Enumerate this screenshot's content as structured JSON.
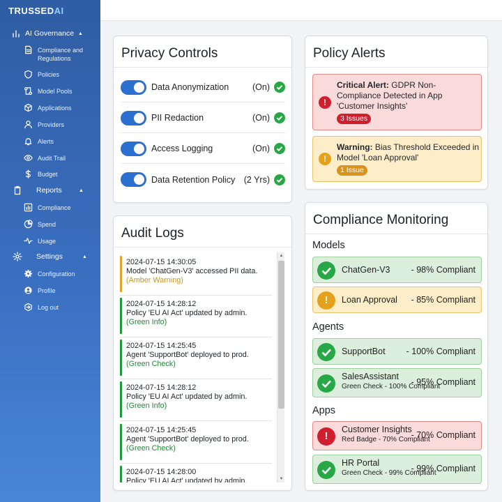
{
  "brand": {
    "name": "TRUSSED",
    "ai_mark": "AI"
  },
  "sidebar": {
    "ai_governance": {
      "label": "AI Governance",
      "items": [
        {
          "label": "Compliance and Regulations",
          "icon": "document-icon"
        },
        {
          "label": "Policies",
          "icon": "shield-icon"
        },
        {
          "label": "Model Pools",
          "icon": "model-pool-icon"
        },
        {
          "label": "Applications",
          "icon": "cube-icon"
        },
        {
          "label": "Providers",
          "icon": "user-icon"
        },
        {
          "label": "Alerts",
          "icon": "bell-icon"
        },
        {
          "label": "Audit Trail",
          "icon": "eye-icon"
        },
        {
          "label": "Budget",
          "icon": "dollar-icon"
        }
      ]
    },
    "reports": {
      "label": "Reports",
      "items": [
        {
          "label": "Compliance",
          "icon": "bar-chart-icon"
        },
        {
          "label": "Spend",
          "icon": "pie-chart-icon"
        },
        {
          "label": "Usage",
          "icon": "activity-icon"
        }
      ]
    },
    "settings": {
      "label": "Settings",
      "items": [
        {
          "label": "Configuration",
          "icon": "gear-icon"
        },
        {
          "label": "Profile",
          "icon": "profile-icon"
        },
        {
          "label": "Log out",
          "icon": "logout-icon"
        }
      ]
    }
  },
  "privacy_controls": {
    "title": "Privacy Controls",
    "rows": [
      {
        "label": "Data Anonymization",
        "state": "(On)"
      },
      {
        "label": "PII Redaction",
        "state": "(On)"
      },
      {
        "label": "Access Logging",
        "state": "(On)"
      },
      {
        "label": "Data Retention Policy",
        "state": "(2 Yrs)"
      }
    ]
  },
  "audit_logs": {
    "title": "Audit Logs",
    "entries": [
      {
        "timestamp": "2024-07-15 14:30:05",
        "message": "Model 'ChatGen-V3' accessed PII data.",
        "tag": "(Amber Warning)",
        "color": "#e0a526"
      },
      {
        "timestamp": "2024-07-15 14:28:12",
        "message": "Policy 'EU AI Act' updated by admin.",
        "tag": "(Green Info)",
        "color": "#1e9a3c"
      },
      {
        "timestamp": "2024-07-15 14:25:45",
        "message": "Agent 'SupportBot' deployed to prod.",
        "tag": "(Green Check)",
        "color": "#1e9a3c"
      },
      {
        "timestamp": "2024-07-15 14:28:12",
        "message": "Policy 'EU AI Act' updated by admin.",
        "tag": "(Green Info)",
        "color": "#1e9a3c"
      },
      {
        "timestamp": "2024-07-15 14:25:45",
        "message": "Agent 'SupportBot' deployed to prod.",
        "tag": "(Green Check)",
        "color": "#1e9a3c"
      },
      {
        "timestamp": "2024-07-15 14:28:00",
        "message": "Policy 'EU AI Act' updated by admin.",
        "tag": "",
        "color": "#1e9a3c"
      }
    ]
  },
  "policy_alerts": {
    "title": "Policy Alerts",
    "alerts": [
      {
        "level": "critical",
        "prefix": "Critical Alert:",
        "text": " GDPR Non-Compliance Detected in App 'Customer Insights'",
        "badge": "3 Issues"
      },
      {
        "level": "warning",
        "prefix": "Warning:",
        "text": " Bias Threshold Exceeded in Model 'Loan Approval'",
        "badge": "1 Issue"
      }
    ]
  },
  "compliance_monitoring": {
    "title": "Compliance Monitoring",
    "models_heading": "Models",
    "agents_heading": "Agents",
    "apps_heading": "Apps",
    "models": [
      {
        "name": "ChatGen-V3",
        "pct": "- 98% Compliant",
        "status": "green"
      },
      {
        "name": "Loan Approval",
        "pct": "- 85% Compliant",
        "status": "amber"
      }
    ],
    "agents": [
      {
        "name": "SupportBot",
        "pct": "- 100% Compliant",
        "status": "green"
      },
      {
        "name": "SalesAssistant",
        "sub": "Green Check - 100% Compliant",
        "pct": "- 95% Compliant",
        "status": "green"
      }
    ],
    "apps": [
      {
        "name": "Customer Insights",
        "sub": "Red Badge - 70% Compliant",
        "pct": "- 70% Compliant",
        "status": "red"
      },
      {
        "name": "HR Portal",
        "sub": "Green Check - 99% Compliant",
        "pct": "- 99% Compliant",
        "status": "green"
      }
    ]
  }
}
